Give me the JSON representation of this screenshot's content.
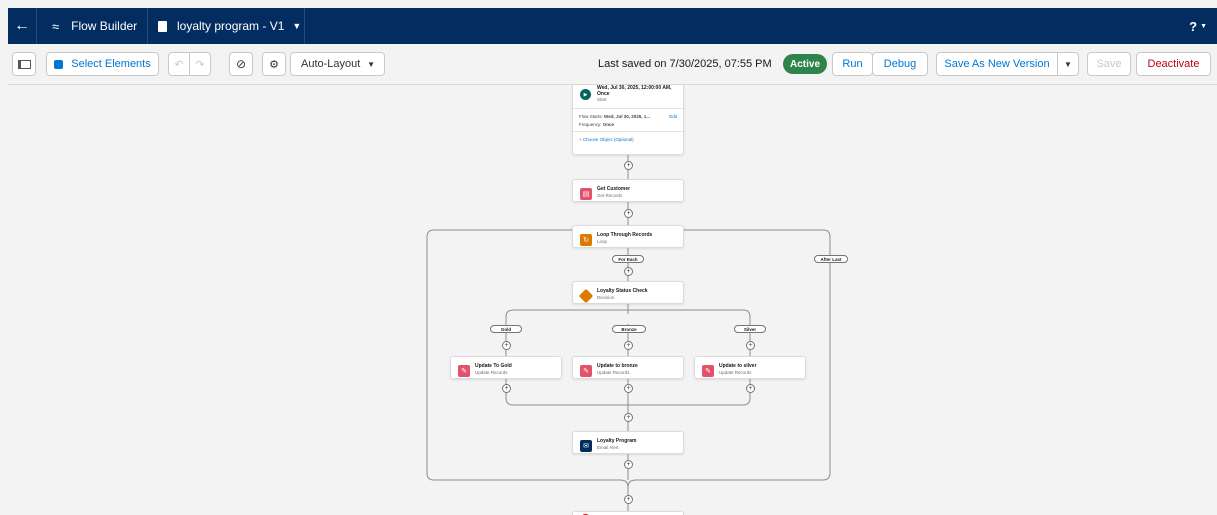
{
  "header": {
    "app_title": "Flow Builder",
    "flow_name": "loyalty program - V1",
    "help_label": "?",
    "icons": {
      "back": "arrow-left-icon",
      "app": "flow-icon",
      "file": "file-icon",
      "dropdown": "chevron-down-icon"
    }
  },
  "toolbar": {
    "select_elements": "Select Elements",
    "layout": "Auto-Layout",
    "last_saved": "Last saved on 7/30/2025, 07:55 PM",
    "status": "Active",
    "run": "Run",
    "debug": "Debug",
    "save_new_version": "Save As New Version",
    "save": "Save",
    "deactivate": "Deactivate",
    "status_color": "#2e844a"
  },
  "canvas": {
    "start": {
      "title": "Wed, Jul 30, 2025, 12:00:00 AM,",
      "title2": "Once",
      "subtitle": "Start",
      "starts_label": "Flow Starts:",
      "starts_value": "Wed, Jul 30, 2025, 1...",
      "edit": "Edit",
      "frequency_label": "Frequency:",
      "frequency_value": "Once",
      "choose_object": "+ Choose Object (Optional)"
    },
    "get_customer": {
      "title": "Get Customer",
      "subtitle": "Get Records",
      "color": "#e3526b"
    },
    "loop": {
      "title": "Loop Through Records",
      "subtitle": "Loop",
      "color": "#dd7a01"
    },
    "for_each": "For Each",
    "after_last": "After Last",
    "decision": {
      "title": "Loyalty Status Check",
      "subtitle": "Decision",
      "color": "#dd7a01"
    },
    "branches": [
      {
        "label": "Gold",
        "title": "Update To Gold",
        "subtitle": "Update Records"
      },
      {
        "label": "Bronze",
        "title": "Update to bronze",
        "subtitle": "Update Records"
      },
      {
        "label": "Silver",
        "title": "Update to silver",
        "subtitle": "Update Records"
      }
    ],
    "update_color": "#e3526b",
    "email": {
      "title": "Loyalty Program",
      "subtitle": "Email Alert",
      "color": "#032d60"
    }
  }
}
